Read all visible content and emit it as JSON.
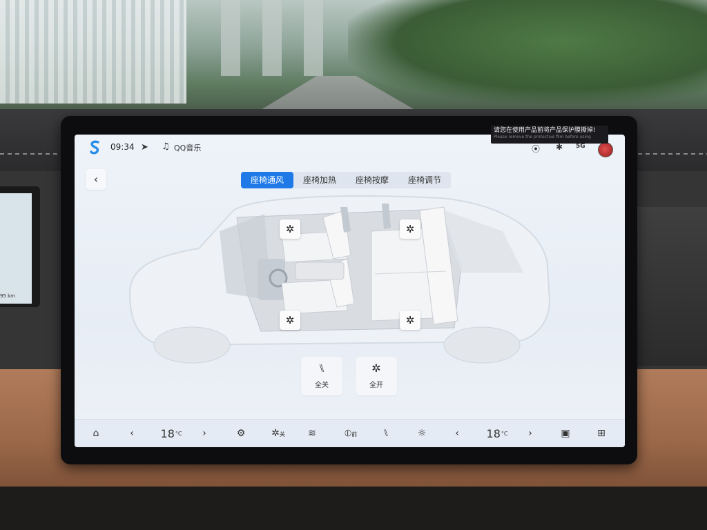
{
  "status": {
    "time": "09:34",
    "music": "QQ音乐",
    "signal": "5G"
  },
  "sticker": {
    "cn": "请您在使用产品前将产品保护膜撕掉!",
    "en": "Please remove the protective film before using"
  },
  "tabs": [
    {
      "label": "座椅通风",
      "active": true
    },
    {
      "label": "座椅加热",
      "active": false
    },
    {
      "label": "座椅按摩",
      "active": false
    },
    {
      "label": "座椅调节",
      "active": false
    }
  ],
  "actions": {
    "all_off": "全关",
    "all_on": "全开"
  },
  "dock": {
    "left_temp": "18",
    "right_temp": "18",
    "temp_unit": "°C",
    "fan_label": "关",
    "defrost_label": "前"
  },
  "side_screen": {
    "text": "95 km"
  },
  "colors": {
    "accent": "#1f7ae8",
    "screen_bg": "#eef3f9"
  }
}
